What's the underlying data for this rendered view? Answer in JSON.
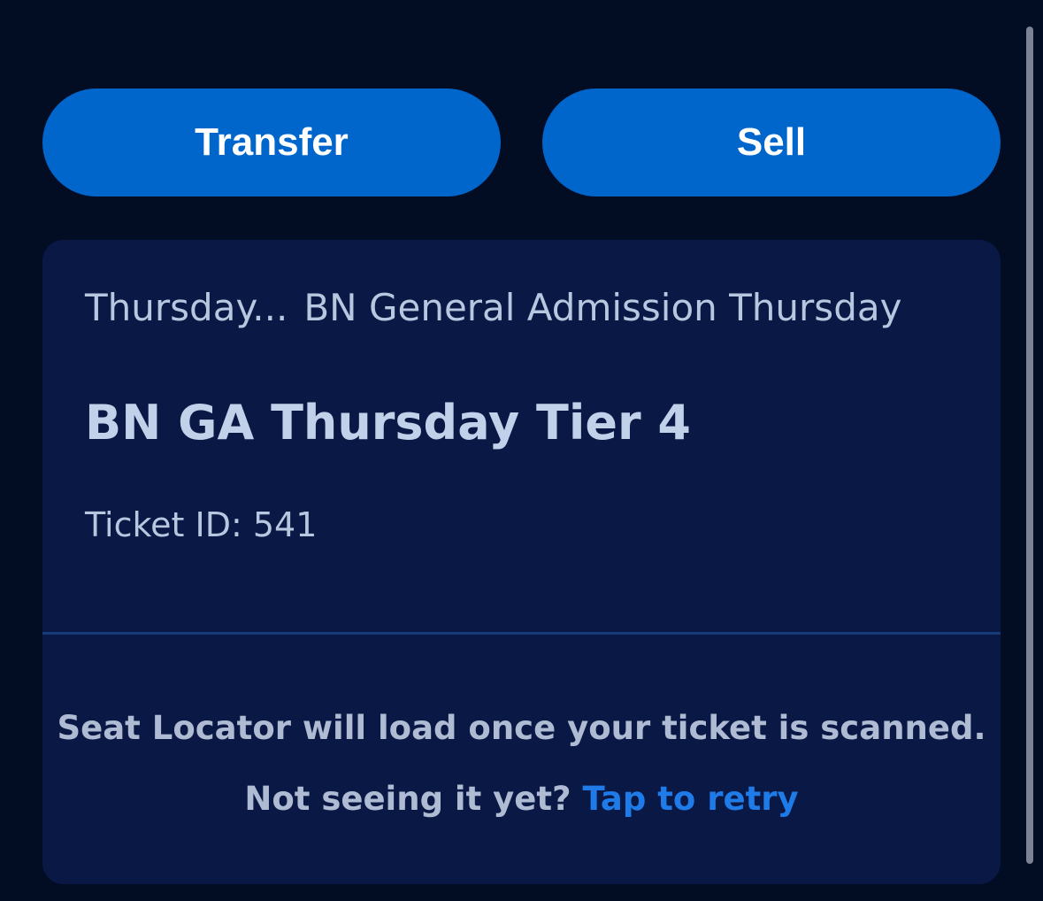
{
  "actions": {
    "transfer_label": "Transfer",
    "sell_label": "Sell"
  },
  "ticket": {
    "day_short": "Thursday...",
    "admission": "BN General Admission Thursday",
    "tier_title": "BN GA Thursday Tier 4",
    "ticket_id": "Ticket ID: 541"
  },
  "seat_locator": {
    "message": "Seat Locator will load once your ticket is scanned.",
    "prompt": "Not seeing it yet?",
    "retry_label": "Tap to retry"
  },
  "colors": {
    "background": "#020d24",
    "button": "#0066cc",
    "card": "#0a1845",
    "link": "#1e7be8"
  }
}
